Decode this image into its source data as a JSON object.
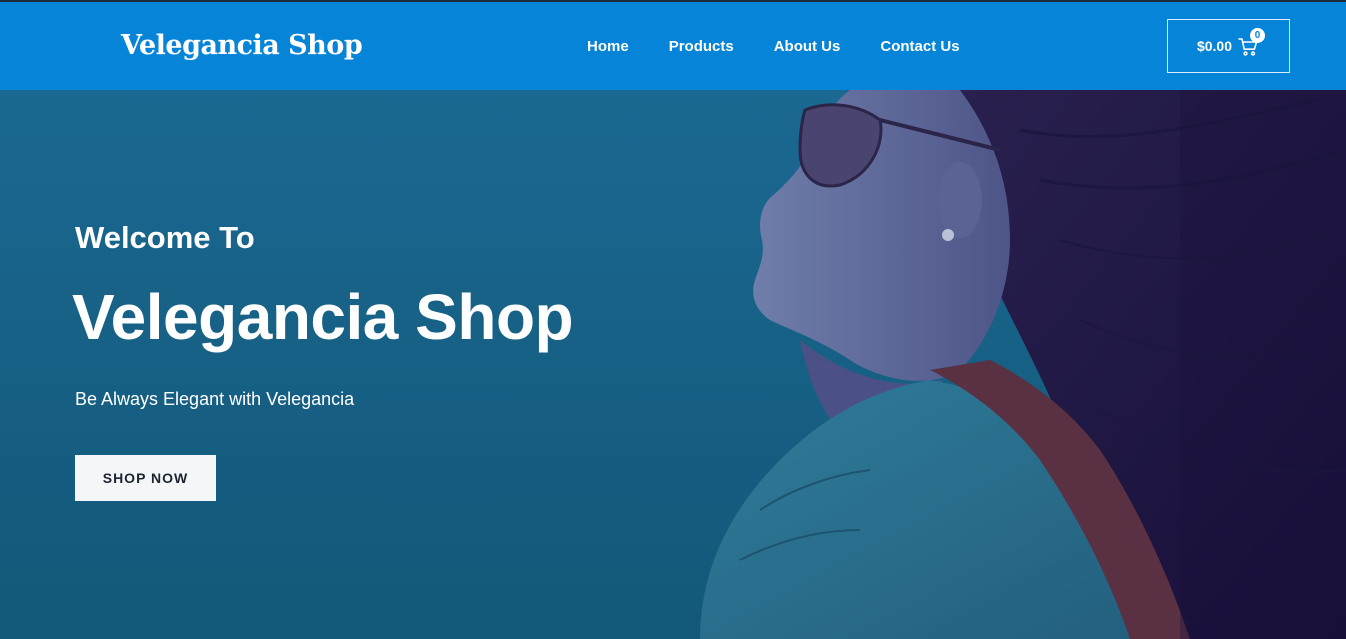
{
  "site": {
    "logo": "Velegancia Shop"
  },
  "nav": {
    "items": [
      {
        "label": "Home"
      },
      {
        "label": "Products"
      },
      {
        "label": "About Us"
      },
      {
        "label": "Contact Us"
      }
    ]
  },
  "cart": {
    "total": "$0.00",
    "count": "0",
    "icon": "shopping-cart-icon"
  },
  "hero": {
    "welcome": "Welcome To",
    "title": "Velegancia Shop",
    "tagline": "Be Always Elegant with Velegancia",
    "cta_label": "SHOP NOW",
    "image": "woman-with-sunglasses-wind-hair"
  },
  "colors": {
    "header_bg": "#0584d8",
    "hero_overlay": "#175f83",
    "button_bg": "#f4f6f8",
    "button_text": "#1c2530",
    "text_white": "#ffffff"
  }
}
